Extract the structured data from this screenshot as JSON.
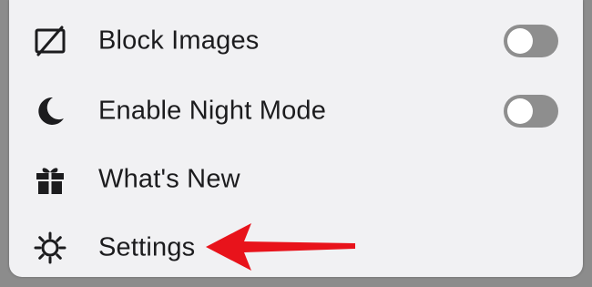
{
  "menu": {
    "items": [
      {
        "label": "Block Images",
        "icon": "block-images-icon",
        "has_toggle": true,
        "toggle_on": false
      },
      {
        "label": "Enable Night Mode",
        "icon": "moon-icon",
        "has_toggle": true,
        "toggle_on": false
      },
      {
        "label": "What's New",
        "icon": "gift-icon",
        "has_toggle": false
      },
      {
        "label": "Settings",
        "icon": "gear-icon",
        "has_toggle": false
      }
    ]
  },
  "annotation": {
    "icon": "red-arrow-icon",
    "color": "#e8131b"
  },
  "colors": {
    "menu_background": "#f1f1f3",
    "toggle_off": "#8e8e8e",
    "text": "#1c1c1e"
  }
}
